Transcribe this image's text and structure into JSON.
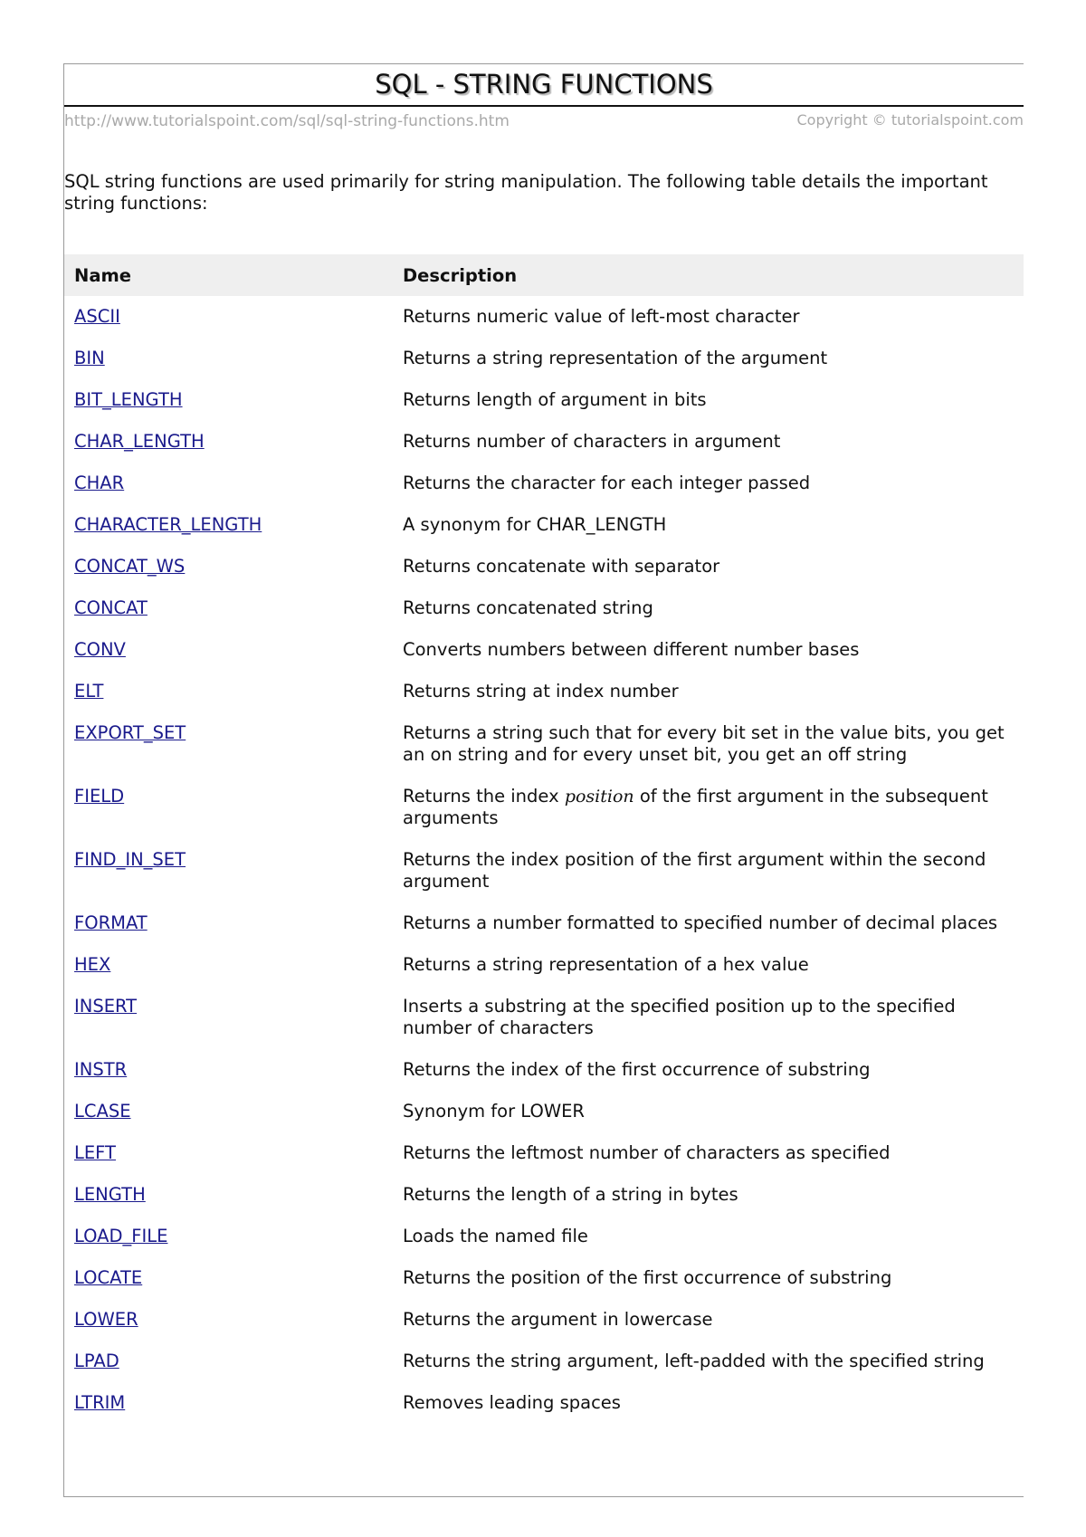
{
  "header": {
    "title": "SQL - STRING FUNCTIONS",
    "url": "http://www.tutorialspoint.com/sql/sql-string-functions.htm",
    "copyright": "Copyright © tutorialspoint.com"
  },
  "intro": "SQL string functions are used primarily for string manipulation. The following table details the important string functions:",
  "table": {
    "columns": [
      "Name",
      "Description"
    ],
    "rows": [
      {
        "name": "ASCII",
        "description": "Returns numeric value of left-most character"
      },
      {
        "name": "BIN",
        "description": "Returns a string representation of the argument"
      },
      {
        "name": "BIT_LENGTH",
        "description": "Returns length of argument in bits"
      },
      {
        "name": "CHAR_LENGTH",
        "description": "Returns number of characters in argument"
      },
      {
        "name": "CHAR",
        "description": "Returns the character for each integer passed"
      },
      {
        "name": "CHARACTER_LENGTH",
        "description": "A synonym for CHAR_LENGTH"
      },
      {
        "name": "CONCAT_WS",
        "description": "Returns concatenate with separator"
      },
      {
        "name": "CONCAT",
        "description": "Returns concatenated string"
      },
      {
        "name": "CONV",
        "description": "Converts numbers between different number bases"
      },
      {
        "name": "ELT",
        "description": "Returns string at index number"
      },
      {
        "name": "EXPORT_SET",
        "description": "Returns a string such that for every bit set in the value bits, you get an on string and for every unset bit, you get an off string"
      },
      {
        "name": "FIELD",
        "description_pre": "Returns the index ",
        "description_em": "position",
        "description_post": " of the first argument in the subsequent arguments"
      },
      {
        "name": "FIND_IN_SET",
        "description": "Returns the index position of the first argument within the second argument"
      },
      {
        "name": "FORMAT",
        "description": "Returns a number formatted to specified number of decimal places"
      },
      {
        "name": "HEX",
        "description": "Returns a string representation of a hex value"
      },
      {
        "name": "INSERT",
        "description": "Inserts a substring at the specified position up to the specified number of characters"
      },
      {
        "name": "INSTR",
        "description": "Returns the index of the first occurrence of substring"
      },
      {
        "name": "LCASE",
        "description": "Synonym for LOWER"
      },
      {
        "name": "LEFT",
        "description": "Returns the leftmost number of characters as specified"
      },
      {
        "name": "LENGTH",
        "description": "Returns the length of a string in bytes"
      },
      {
        "name": "LOAD_FILE",
        "description": "Loads the named file"
      },
      {
        "name": "LOCATE",
        "description": "Returns the position of the first occurrence of substring"
      },
      {
        "name": "LOWER",
        "description": "Returns the argument in lowercase"
      },
      {
        "name": "LPAD",
        "description": "Returns the string argument, left-padded with the specified string"
      },
      {
        "name": "LTRIM",
        "description": "Removes leading spaces"
      }
    ]
  },
  "colors": {
    "link": "#1a1a8c",
    "header_bg": "#efefef",
    "muted_text": "#a9a9a9"
  }
}
